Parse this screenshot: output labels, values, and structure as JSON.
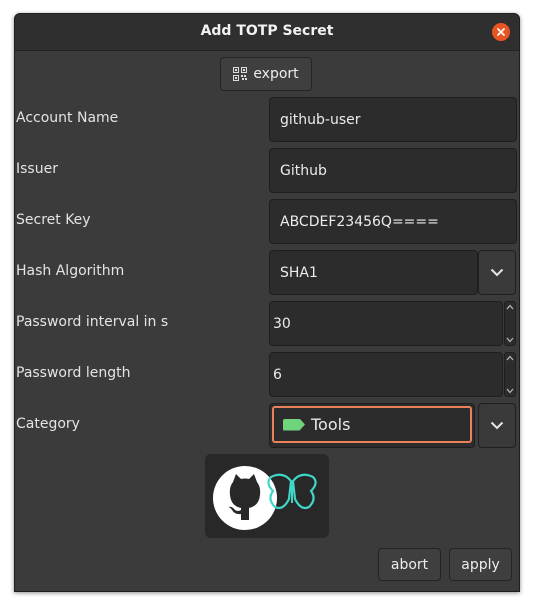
{
  "window": {
    "title": "Add TOTP Secret"
  },
  "toolbar": {
    "export_label": "export"
  },
  "form": {
    "account_name": {
      "label": "Account Name",
      "value": "github-user"
    },
    "issuer": {
      "label": "Issuer",
      "value": "Github"
    },
    "secret_key": {
      "label": "Secret Key",
      "value": "ABCDEF23456Q===="
    },
    "hash_algorithm": {
      "label": "Hash Algorithm",
      "value": "SHA1"
    },
    "password_interval": {
      "label": "Password interval in s",
      "value": "30"
    },
    "password_length": {
      "label": "Password length",
      "value": "6"
    },
    "category": {
      "label": "Category",
      "value": "Tools",
      "tag_color": "#6fd47b"
    }
  },
  "actions": {
    "abort_label": "abort",
    "apply_label": "apply"
  },
  "colors": {
    "accent": "#e95420",
    "focus": "#e9825a",
    "logo_teal": "#3fd6c6"
  },
  "icons": [
    "close-icon",
    "qr-code-icon",
    "chevron-down-icon",
    "chevron-up-icon",
    "tag-icon",
    "github-octocat-icon",
    "butterfly-icon"
  ]
}
